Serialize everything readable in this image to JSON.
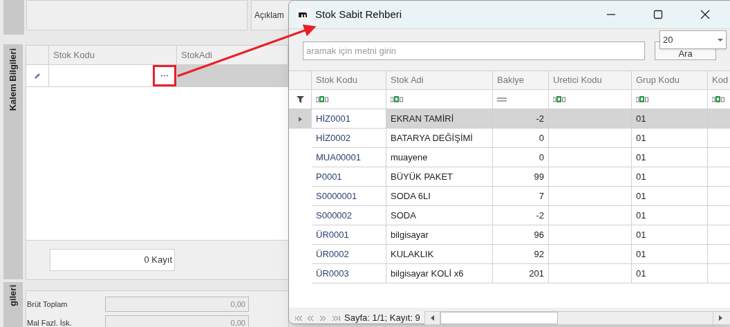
{
  "background_form": {
    "description_label": "Açıklam",
    "side_tab": "Kalem Bilgileri",
    "grid_columns": [
      "Stok Kodu",
      "StokAdi"
    ],
    "record_count": "0 Kayıt",
    "totals_tab": "gileri",
    "totals": [
      {
        "label": "Brüt Toplam",
        "value": "0,00"
      },
      {
        "label": "Mal Fazl. İsk.",
        "value": "0,00"
      }
    ]
  },
  "dialog": {
    "title": "Stok Sabit Rehberi",
    "search": {
      "placeholder": "aramak için metni girin"
    },
    "search_button": "Ara",
    "page_size": "20",
    "columns": [
      {
        "label": "Stok Kodu",
        "kind": "text"
      },
      {
        "label": "Stok Adi",
        "kind": "text"
      },
      {
        "label": "Bakiye",
        "kind": "number"
      },
      {
        "label": "Uretici Kodu",
        "kind": "text"
      },
      {
        "label": "Grup Kodu",
        "kind": "text"
      },
      {
        "label": "Kod",
        "kind": "text"
      }
    ],
    "rows": [
      {
        "cells": [
          "HİZ0001",
          "EKRAN TAMİRİ",
          "-2",
          "",
          "01"
        ],
        "selected": true
      },
      {
        "cells": [
          "HİZ0002",
          "BATARYA DEĞİŞİMİ",
          "0",
          "",
          "01"
        ],
        "selected": false
      },
      {
        "cells": [
          "MUA00001",
          "muayene",
          "0",
          "",
          "01"
        ],
        "selected": false
      },
      {
        "cells": [
          "P0001",
          "BÜYÜK PAKET",
          "99",
          "",
          "01"
        ],
        "selected": false
      },
      {
        "cells": [
          "S0000001",
          "SODA 6LI",
          "7",
          "",
          "01"
        ],
        "selected": false
      },
      {
        "cells": [
          "S000002",
          "SODA",
          "-2",
          "",
          "01"
        ],
        "selected": false
      },
      {
        "cells": [
          "ÜR0001",
          "bilgisayar",
          "96",
          "",
          "01"
        ],
        "selected": false
      },
      {
        "cells": [
          "ÜR0002",
          "KULAKLIK",
          "92",
          "",
          "01"
        ],
        "selected": false
      },
      {
        "cells": [
          "ÜR0003",
          "bilgisayar KOLİ x6",
          "201",
          "",
          "01"
        ],
        "selected": false
      }
    ],
    "pager": "Sayfa: 1/1; Kayıt: 9"
  }
}
